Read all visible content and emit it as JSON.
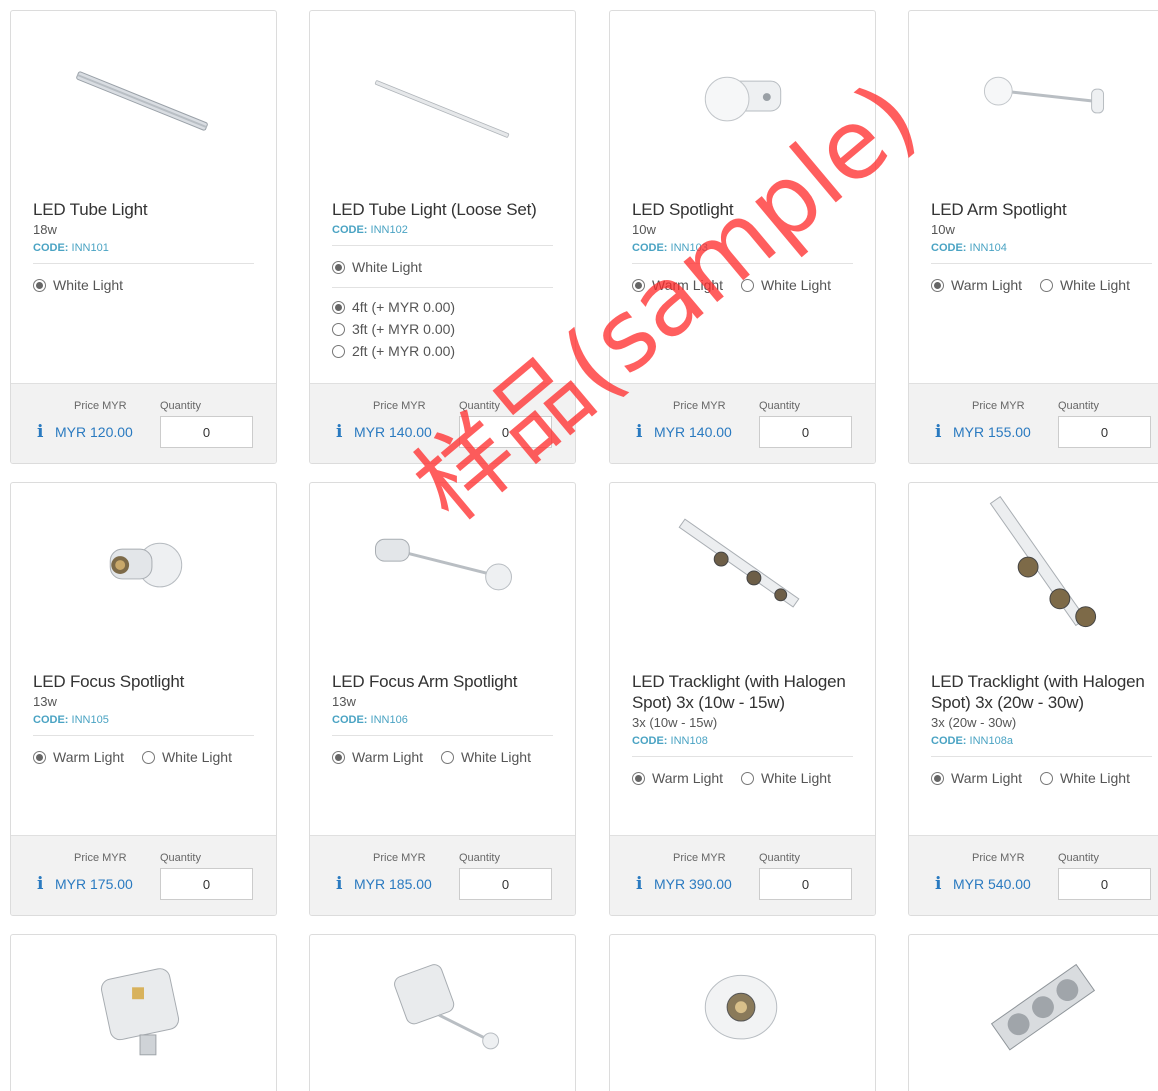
{
  "labels": {
    "price": "Price MYR",
    "quantity": "Quantity"
  },
  "cards": [
    {
      "title": "LED Tube Light",
      "spec": "18w",
      "code_label": "CODE:",
      "code": "INN101",
      "options": [
        "White Light"
      ],
      "price": "MYR 120.00",
      "qty": "0",
      "icon": "tube-light"
    },
    {
      "title": "LED Tube Light (Loose Set)",
      "code_label": "CODE:",
      "code": "INN102",
      "options": [
        "White Light"
      ],
      "sizes": [
        "4ft (+ MYR 0.00)",
        "3ft (+ MYR 0.00)",
        "2ft (+ MYR 0.00)"
      ],
      "price": "MYR 140.00",
      "qty": "0",
      "icon": "tube-light-thin"
    },
    {
      "title": "LED Spotlight",
      "spec": "10w",
      "code_label": "CODE:",
      "code": "INN103",
      "options": [
        "Warm Light",
        "White Light"
      ],
      "price": "MYR 140.00",
      "qty": "0",
      "icon": "spotlight"
    },
    {
      "title": "LED Arm Spotlight",
      "spec": "10w",
      "code_label": "CODE:",
      "code": "INN104",
      "options": [
        "Warm Light",
        "White Light"
      ],
      "price": "MYR 155.00",
      "qty": "0",
      "icon": "arm-spotlight"
    },
    {
      "title": "LED Focus Spotlight",
      "spec": "13w",
      "code_label": "CODE:",
      "code": "INN105",
      "options": [
        "Warm Light",
        "White Light"
      ],
      "price": "MYR 175.00",
      "qty": "0",
      "icon": "focus-spotlight"
    },
    {
      "title": "LED Focus Arm Spotlight",
      "spec": "13w",
      "code_label": "CODE:",
      "code": "INN106",
      "options": [
        "Warm Light",
        "White Light"
      ],
      "price": "MYR 185.00",
      "qty": "0",
      "icon": "focus-arm-spotlight"
    },
    {
      "title": "LED Tracklight (with Halogen Spot) 3x (10w - 15w)",
      "spec": "3x (10w - 15w)",
      "code_label": "CODE:",
      "code": "INN108",
      "options": [
        "Warm Light",
        "White Light"
      ],
      "price": "MYR 390.00",
      "qty": "0",
      "icon": "tracklight"
    },
    {
      "title": "LED Tracklight (with Halogen Spot) 3x (20w - 30w)",
      "spec": "3x (20w - 30w)",
      "code_label": "CODE:",
      "code": "INN108a",
      "options": [
        "Warm Light",
        "White Light"
      ],
      "price": "MYR 540.00",
      "qty": "0",
      "icon": "tracklight-large"
    },
    {
      "icon": "floodlight"
    },
    {
      "icon": "arm-floodlight"
    },
    {
      "icon": "downlight"
    },
    {
      "icon": "triple-grille-downlight"
    }
  ],
  "watermark": "样品(sample)"
}
